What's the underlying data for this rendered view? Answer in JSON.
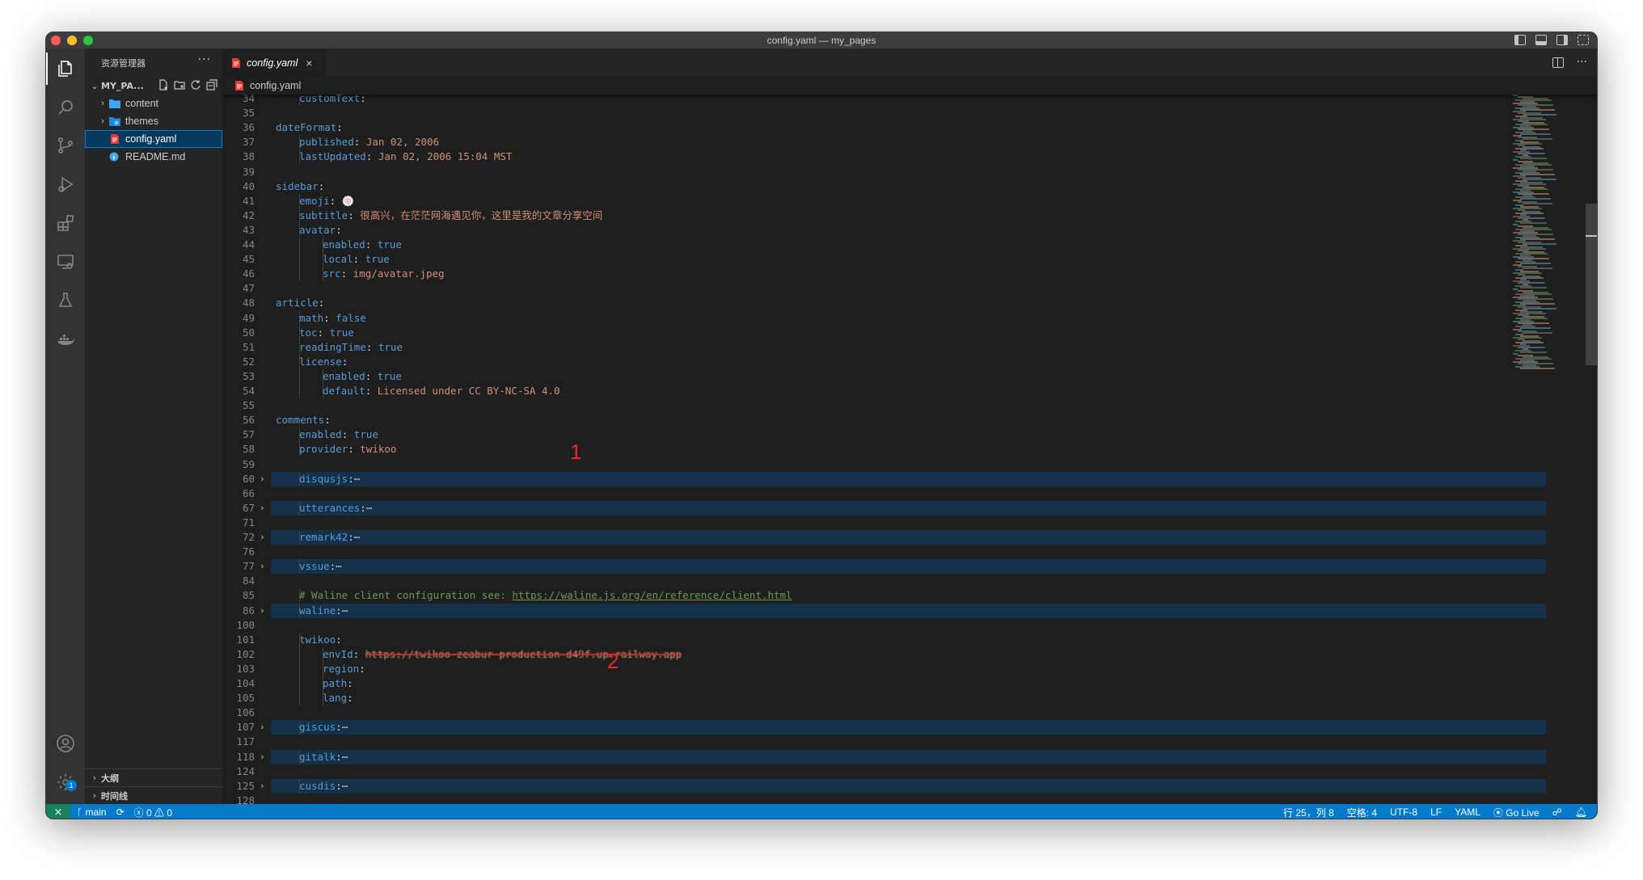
{
  "window": {
    "title": "config.yaml — my_pages"
  },
  "sidebar": {
    "header": "资源管理器",
    "more": "···",
    "folder": "MY_PA...",
    "items": [
      {
        "label": "content",
        "type": "folder"
      },
      {
        "label": "themes",
        "type": "folder"
      },
      {
        "label": "config.yaml",
        "type": "yaml",
        "selected": true
      },
      {
        "label": "README.md",
        "type": "md"
      }
    ],
    "outline": "大纲",
    "timeline": "时间线"
  },
  "activity": {
    "settings_badge": "1"
  },
  "tab": {
    "label": "config.yaml",
    "close": "×"
  },
  "breadcrumb": {
    "file": "config.yaml"
  },
  "editor": {
    "lines": [
      {
        "n": "34",
        "indent": 2,
        "key": "customText",
        "val": "",
        "partial": true
      },
      {
        "n": "35"
      },
      {
        "n": "36",
        "indent": 1,
        "key": "dateFormat"
      },
      {
        "n": "37",
        "indent": 2,
        "key": "published",
        "val": "Jan 02, 2006"
      },
      {
        "n": "38",
        "indent": 2,
        "key": "lastUpdated",
        "val": "Jan 02, 2006 15:04 MST"
      },
      {
        "n": "39"
      },
      {
        "n": "40",
        "indent": 1,
        "key": "sidebar"
      },
      {
        "n": "41",
        "indent": 2,
        "key": "emoji",
        "val": "🍥"
      },
      {
        "n": "42",
        "indent": 2,
        "key": "subtitle",
        "val": "很高兴，在茫茫网海遇见你，这里是我的文章分享空间"
      },
      {
        "n": "43",
        "indent": 2,
        "key": "avatar"
      },
      {
        "n": "44",
        "indent": 3,
        "key": "enabled",
        "val": "true",
        "bool": true
      },
      {
        "n": "45",
        "indent": 3,
        "key": "local",
        "val": "true",
        "bool": true
      },
      {
        "n": "46",
        "indent": 3,
        "key": "src",
        "val": "img/avatar.jpeg"
      },
      {
        "n": "47"
      },
      {
        "n": "48",
        "indent": 1,
        "key": "article"
      },
      {
        "n": "49",
        "indent": 2,
        "key": "math",
        "val": "false",
        "bool": true
      },
      {
        "n": "50",
        "indent": 2,
        "key": "toc",
        "val": "true",
        "bool": true
      },
      {
        "n": "51",
        "indent": 2,
        "key": "readingTime",
        "val": "true",
        "bool": true
      },
      {
        "n": "52",
        "indent": 2,
        "key": "license"
      },
      {
        "n": "53",
        "indent": 3,
        "key": "enabled",
        "val": "true",
        "bool": true
      },
      {
        "n": "54",
        "indent": 3,
        "key": "default",
        "val": "Licensed under CC BY-NC-SA 4.0"
      },
      {
        "n": "55"
      },
      {
        "n": "56",
        "indent": 1,
        "key": "comments"
      },
      {
        "n": "57",
        "indent": 2,
        "key": "enabled",
        "val": "true",
        "bool": true
      },
      {
        "n": "58",
        "indent": 2,
        "key": "provider",
        "val": "twikoo"
      },
      {
        "n": "59"
      },
      {
        "n": "60",
        "indent": 2,
        "key": "disqusjs",
        "folded": true
      },
      {
        "n": "66"
      },
      {
        "n": "67",
        "indent": 2,
        "key": "utterances",
        "folded": true
      },
      {
        "n": "71"
      },
      {
        "n": "72",
        "indent": 2,
        "key": "remark42",
        "folded": true
      },
      {
        "n": "76"
      },
      {
        "n": "77",
        "indent": 2,
        "key": "vssue",
        "folded": true
      },
      {
        "n": "84"
      },
      {
        "n": "85",
        "indent": 2,
        "comment": "# Waline client configuration see: ",
        "url": "https://waline.js.org/en/reference/client.html"
      },
      {
        "n": "86",
        "indent": 2,
        "key": "waline",
        "folded": true
      },
      {
        "n": "100"
      },
      {
        "n": "101",
        "indent": 2,
        "key": "twikoo"
      },
      {
        "n": "102",
        "indent": 3,
        "key": "envId",
        "val": "https://twikoo-zeabur-production-d49f.up.railway.app",
        "redacted": true
      },
      {
        "n": "103",
        "indent": 3,
        "key": "region"
      },
      {
        "n": "104",
        "indent": 3,
        "key": "path"
      },
      {
        "n": "105",
        "indent": 3,
        "key": "lang"
      },
      {
        "n": "106"
      },
      {
        "n": "107",
        "indent": 2,
        "key": "giscus",
        "folded": true
      },
      {
        "n": "117"
      },
      {
        "n": "118",
        "indent": 2,
        "key": "gitalk",
        "folded": true
      },
      {
        "n": "124"
      },
      {
        "n": "125",
        "indent": 2,
        "key": "cusdis",
        "folded": true
      },
      {
        "n": "128"
      }
    ],
    "fold_marker": "⋯",
    "annotations": [
      "1",
      "2"
    ]
  },
  "statusbar": {
    "branch": "main",
    "errors": "0",
    "warnings": "0",
    "position": "行 25，列 8",
    "spaces": "空格: 4",
    "encoding": "UTF-8",
    "eol": "LF",
    "language": "YAML",
    "golive": "Go Live"
  },
  "colors": {
    "key": "#569cd6",
    "string": "#ce9178",
    "comment": "#6a9955",
    "statusbar": "#007acc",
    "annotation": "#e8282b"
  }
}
